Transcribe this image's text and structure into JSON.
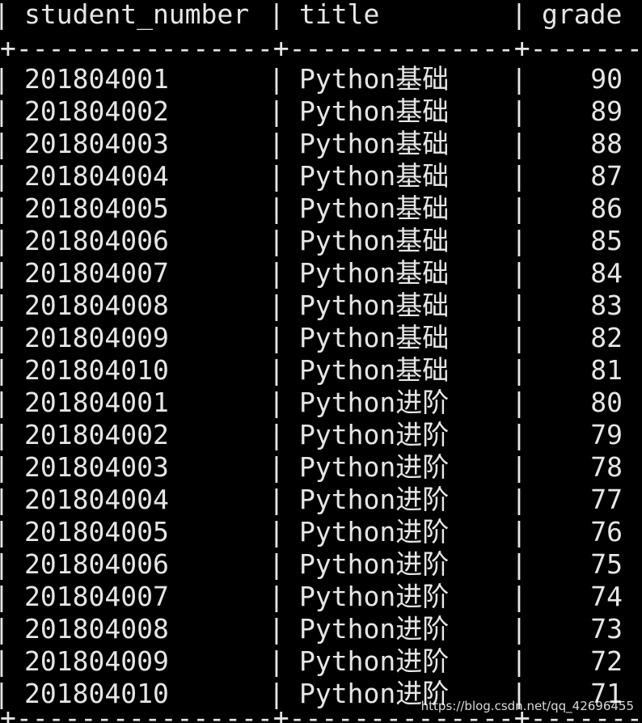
{
  "table": {
    "columns": [
      "student_number",
      "title",
      "grade"
    ],
    "separator": "+----------------+--------------+--------",
    "bottom_separator": "+----------------+--------------+--------",
    "rows": [
      {
        "student_number": "201804001",
        "title": "Python基础",
        "grade": "90"
      },
      {
        "student_number": "201804002",
        "title": "Python基础",
        "grade": "89"
      },
      {
        "student_number": "201804003",
        "title": "Python基础",
        "grade": "88"
      },
      {
        "student_number": "201804004",
        "title": "Python基础",
        "grade": "87"
      },
      {
        "student_number": "201804005",
        "title": "Python基础",
        "grade": "86"
      },
      {
        "student_number": "201804006",
        "title": "Python基础",
        "grade": "85"
      },
      {
        "student_number": "201804007",
        "title": "Python基础",
        "grade": "84"
      },
      {
        "student_number": "201804008",
        "title": "Python基础",
        "grade": "83"
      },
      {
        "student_number": "201804009",
        "title": "Python基础",
        "grade": "82"
      },
      {
        "student_number": "201804010",
        "title": "Python基础",
        "grade": "81"
      },
      {
        "student_number": "201804001",
        "title": "Python进阶",
        "grade": "80"
      },
      {
        "student_number": "201804002",
        "title": "Python进阶",
        "grade": "79"
      },
      {
        "student_number": "201804003",
        "title": "Python进阶",
        "grade": "78"
      },
      {
        "student_number": "201804004",
        "title": "Python进阶",
        "grade": "77"
      },
      {
        "student_number": "201804005",
        "title": "Python进阶",
        "grade": "76"
      },
      {
        "student_number": "201804006",
        "title": "Python进阶",
        "grade": "75"
      },
      {
        "student_number": "201804007",
        "title": "Python进阶",
        "grade": "74"
      },
      {
        "student_number": "201804008",
        "title": "Python进阶",
        "grade": "73"
      },
      {
        "student_number": "201804009",
        "title": "Python进阶",
        "grade": "72"
      },
      {
        "student_number": "201804010",
        "title": "Python进阶",
        "grade": "71"
      }
    ]
  },
  "watermark": "https://blog.csdn.net/qq_42696455",
  "colors": {
    "background": "#000000",
    "text": "#e6e6e6"
  }
}
